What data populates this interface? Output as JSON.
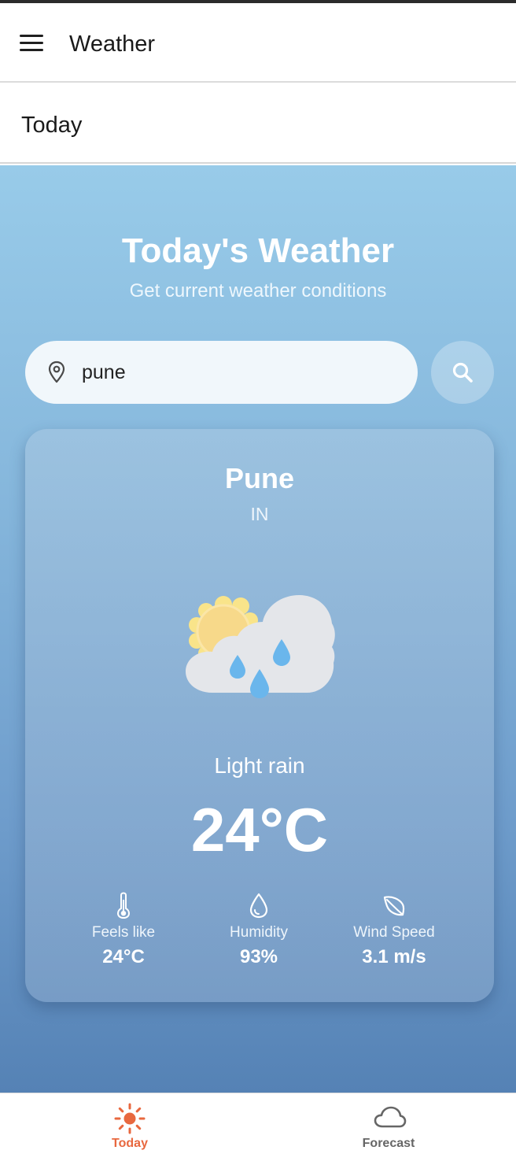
{
  "app": {
    "title": "Weather"
  },
  "section": {
    "title": "Today"
  },
  "hero": {
    "title": "Today's Weather",
    "subtitle": "Get current weather conditions"
  },
  "search": {
    "value": "pune",
    "icon": "search-icon",
    "location_icon": "map-pin-icon"
  },
  "weather": {
    "city": "Pune",
    "country": "IN",
    "condition": "Light rain",
    "icon": "sun-cloud-rain-icon",
    "temperature": "24°C",
    "stats": [
      {
        "label": "Feels like",
        "value": "24°C",
        "icon": "thermometer-icon"
      },
      {
        "label": "Humidity",
        "value": "93%",
        "icon": "droplet-icon"
      },
      {
        "label": "Wind Speed",
        "value": "3.1 m/s",
        "icon": "leaf-icon"
      }
    ]
  },
  "nav": {
    "items": [
      {
        "label": "Today",
        "icon": "sun-icon",
        "active": true
      },
      {
        "label": "Forecast",
        "icon": "cloud-icon",
        "active": false
      }
    ]
  },
  "colors": {
    "accent": "#e8683f",
    "gradient_top": "#98cbe9",
    "gradient_bottom": "#5582b5"
  }
}
